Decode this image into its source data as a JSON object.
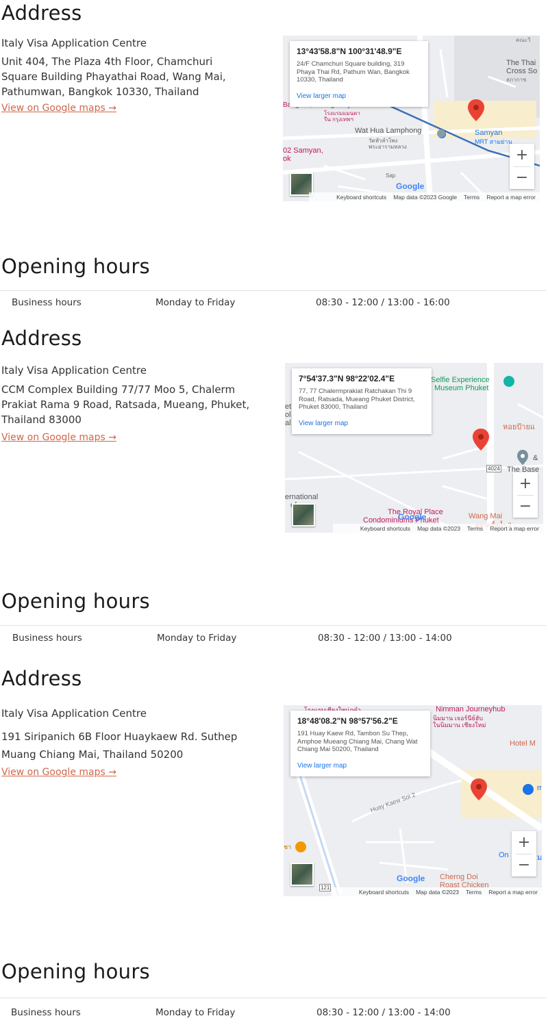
{
  "common": {
    "address_heading": "Address",
    "hours_heading": "Opening hours",
    "centre_name": "Italy Visa Application Centre",
    "maps_link": "View on Google maps →",
    "hours_label": "Business hours",
    "days": "Monday to Friday",
    "view_larger_map": "View larger map",
    "zoom_in": "+",
    "zoom_out": "−",
    "google": "Google",
    "keyboard_shortcuts": "Keyboard shortcuts",
    "terms": "Terms",
    "report_error": "Report a map error"
  },
  "locations": [
    {
      "address_line1": "Unit 404, The Plaza 4th Floor, Chamchuri",
      "address_line2": "Square Building Phayathai Road, Wang Mai,",
      "address_line3": "Pathumwan, Bangkok 10330, Thailand",
      "hours": "08:30 - 12:00 / 13:00 - 16:00",
      "map": {
        "coords": "13°43'58.8\"N 100°31'48.9\"E",
        "card_address": "24/F Chamchuri Square building, 319 Phaya Thai Rd, Pathum Wan, Bangkok 10330, Thailand",
        "map_data": "Map data ©2023 Google",
        "labels": [
          "Wat Hua Lamphong",
          "วัดหัวลำโพง",
          "พระอารามหลวง",
          "Samyan",
          "MRT สามย่าน",
          "The Thai",
          "Cross So",
          "สภากาช",
          "02 Samyan,",
          "ok",
          "Bangkok, Managed by...",
          "โรงแรมแมนดา",
          "รีน กรุงเทพฯ",
          "Sap",
          "คณะวิ"
        ]
      }
    },
    {
      "address_line1": "CCM Complex Building 77/77 Moo 5, Chalerm",
      "address_line2": "Prakiat Rama 9 Road, Ratsada, Mueang, Phuket,",
      "address_line3": "Thailand 83000",
      "hours": "08:30 - 12:00 / 13:00 - 14:00",
      "map": {
        "coords": "7°54'37.3\"N 98°22'02.4\"E",
        "card_address": "77, 77 Chalermprakiat Ratchakan Thi 9 Road, Ratsada, Mueang Phuket District, Phuket 83000, Thailand",
        "map_data": "Map data ©2023",
        "labels": [
          "Selfie Experience",
          "Museum Phuket",
          "หอยป้ายแ",
          "The Base",
          "&",
          "4024",
          "ernational",
          "of",
          "The Royal Place",
          "Condominiums Phuket",
          "Wang Mai",
          "ตลาดซื้อน้ำ 2 ...",
          "et",
          "ol",
          "al"
        ]
      }
    },
    {
      "address_line1": "191 Siripanich 6B Floor Huaykaew Rd. Suthep",
      "address_line2": "Muang Chiang Mai, Thailand 50200",
      "address_line3": "",
      "hours": "08:30 - 12:00 / 13:00 - 14:00",
      "map": {
        "coords": "18°48'08.2\"N 98°57'56.2\"E",
        "card_address": "191 Huay Kaew Rd, Tambon Su Thep, Amphoe Mueang Chiang Mai, Chang Wat Chiang Mai 50200, Thailand",
        "map_data": "Map data ©2023",
        "labels": [
          "Nimman Journeyhub",
          "นิมมาน เจอร์นีย์ฮับ",
          "Hotel M",
          "Huay Kaew Soi 2",
          "Cherng Doi",
          "Roast Chicken",
          "On",
          "m",
          "ม",
          "121",
          "โรงแรมเชียงใหม่ภูคำ",
          "ในนิมมาน เชียงใหม่",
          "ชา"
        ]
      }
    }
  ],
  "colors": {
    "link": "#d0674a",
    "pin": "#ea4335",
    "map_link": "#1a73e8",
    "transit": "#1a73e8"
  }
}
